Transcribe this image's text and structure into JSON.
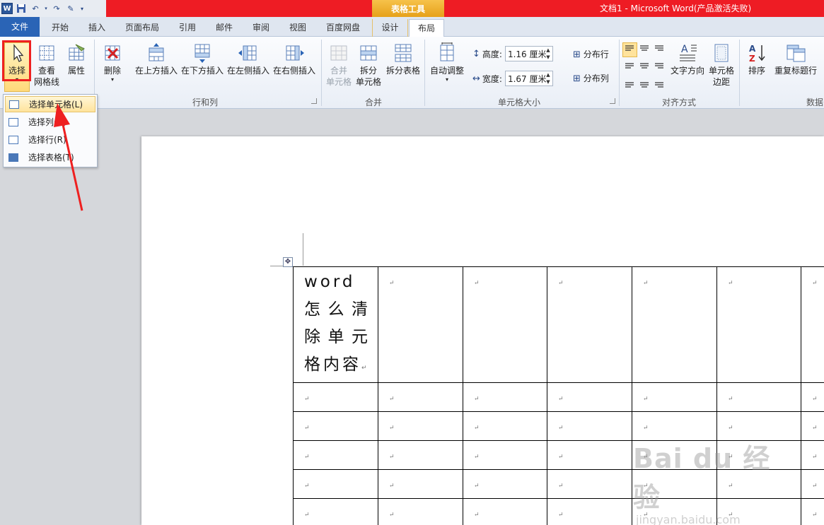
{
  "title_bar": {
    "window_title": "文档1 - Microsoft Word(产品激活失败)",
    "context_label": "表格工具"
  },
  "tabs": [
    {
      "label": "文件"
    },
    {
      "label": "开始"
    },
    {
      "label": "插入"
    },
    {
      "label": "页面布局"
    },
    {
      "label": "引用"
    },
    {
      "label": "邮件"
    },
    {
      "label": "审阅"
    },
    {
      "label": "视图"
    },
    {
      "label": "百度网盘"
    },
    {
      "label": "设计"
    },
    {
      "label": "布局"
    }
  ],
  "active_tab": "布局",
  "ribbon": {
    "table_group": {
      "select": "选择",
      "view_gridlines_1": "查看",
      "view_gridlines_2": "网格线",
      "properties": "属性"
    },
    "rows_cols": {
      "delete": "删除",
      "insert_above": "在上方插入",
      "insert_below": "在下方插入",
      "insert_left": "在左侧插入",
      "insert_right": "在右侧插入",
      "group_name": "行和列"
    },
    "merge": {
      "merge_cells_1": "合并",
      "merge_cells_2": "单元格",
      "split_cells_1": "拆分",
      "split_cells_2": "单元格",
      "split_table": "拆分表格",
      "group_name": "合并"
    },
    "cell_size": {
      "autofit": "自动调整",
      "height_label": "高度:",
      "height_value": "1.16 厘米",
      "width_label": "宽度:",
      "width_value": "1.67 厘米",
      "distribute_rows": "分布行",
      "distribute_cols": "分布列",
      "group_name": "单元格大小"
    },
    "alignment": {
      "text_direction": "文字方向",
      "cell_margins_1": "单元格",
      "cell_margins_2": "边距",
      "group_name": "对齐方式"
    },
    "data": {
      "sort": "排序",
      "repeat_header": "重复标题行",
      "group_name": "数据"
    }
  },
  "select_menu": {
    "items": [
      {
        "label": "选择单元格(L)"
      },
      {
        "label": "选择列(C)"
      },
      {
        "label": "选择行(R)"
      },
      {
        "label": "选择表格(T)"
      }
    ]
  },
  "document": {
    "first_cell_text": "word 怎么清除单元格内容",
    "paragraph_mark": "↵"
  },
  "watermark": {
    "line1": "Bai du 经验",
    "line2": "jingyan.baidu.com"
  },
  "colors": {
    "title_red": "#ee1c24",
    "file_tab_blue": "#2a64b6",
    "annotation_red": "#ee2020",
    "context_gold": "#e6a11a"
  }
}
